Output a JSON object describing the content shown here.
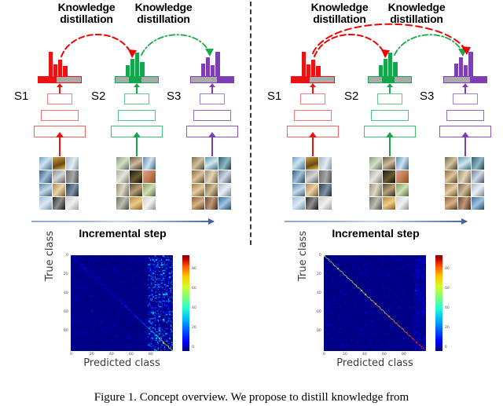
{
  "figure": {
    "caption": "Figure 1. Concept overview. We propose to distill knowledge from",
    "divider": "vertical-dashed-separator"
  },
  "panels": [
    {
      "id": "left",
      "kd_titles": [
        {
          "line1": "Knowledge",
          "line2": "distillation",
          "color": "#000000"
        },
        {
          "line1": "Knowledge",
          "line2": "distillation",
          "color": "#000000"
        }
      ],
      "arcs": [
        {
          "from": "S1",
          "to": "S2",
          "color": "#ee0000",
          "style": "dashed"
        },
        {
          "from": "S2",
          "to": "S3",
          "color": "#1aa94a",
          "style": "dash-dot"
        }
      ],
      "students": [
        {
          "label": "S1",
          "color": "#ee1111",
          "bar_segments": [
            "color",
            "gray"
          ]
        },
        {
          "label": "S2",
          "color": "#13a64a",
          "bar_segments": [
            "gray",
            "color",
            "gray"
          ]
        },
        {
          "label": "S3",
          "color": "#7e3fb5",
          "bar_segments": [
            "gray",
            "color"
          ]
        }
      ],
      "incremental": {
        "label": "Incremental step",
        "arrow": "right-arrow"
      }
    },
    {
      "id": "right",
      "kd_titles": [
        {
          "line1": "Knowledge",
          "line2": "distillation",
          "color": "#000000"
        },
        {
          "line1": "Knowledge",
          "line2": "distillation",
          "color": "#000000"
        }
      ],
      "arcs": [
        {
          "from": "S1",
          "to": "S2",
          "color": "#ee0000",
          "style": "dashed"
        },
        {
          "from": "S2",
          "to": "S3",
          "color": "#1aa94a",
          "style": "dash-dot"
        },
        {
          "from": "S1",
          "to": "S3",
          "color": "#ee0000",
          "style": "dashed"
        }
      ],
      "students": [
        {
          "label": "S1",
          "color": "#ee1111",
          "bar_segments": [
            "color",
            "gray"
          ]
        },
        {
          "label": "S2",
          "color": "#13a64a",
          "bar_segments": [
            "gray",
            "color",
            "gray"
          ]
        },
        {
          "label": "S3",
          "color": "#7e3fb5",
          "bar_segments": [
            "gray",
            "color"
          ]
        }
      ],
      "incremental": {
        "label": "Incremental step",
        "arrow": "right-arrow"
      }
    }
  ],
  "chart_data": [
    {
      "id": "confusion-matrix-left",
      "type": "heatmap",
      "title": "",
      "xlabel": "Predicted class",
      "ylabel": "True class",
      "xticks": [
        0,
        20,
        40,
        60,
        80
      ],
      "yticks": [
        0,
        20,
        40,
        60,
        80
      ],
      "xlim": [
        0,
        100
      ],
      "ylim": [
        0,
        100
      ],
      "colormap": "jet",
      "colorbar": {
        "ticks": [
          0,
          20,
          40,
          60,
          80
        ],
        "vmin": 0,
        "vmax": 95,
        "position": "right"
      },
      "grid": false,
      "description": "Confusion matrix of a baseline incremental learner: weak faint diagonal for early classes, strong red diagonal only near the last classes, heavy prediction bias toward the most recent classes (bright scattered column band on the right).",
      "diagonal_strength": [
        2,
        3,
        4,
        5,
        6,
        8,
        10,
        14,
        20,
        55
      ],
      "recency_bias_band": {
        "start_class": 75,
        "end_class": 100,
        "intensity": 30
      }
    },
    {
      "id": "confusion-matrix-right",
      "type": "heatmap",
      "title": "",
      "xlabel": "Predicted class",
      "ylabel": "True class",
      "xticks": [
        0,
        20,
        40,
        60,
        80
      ],
      "yticks": [
        0,
        20,
        40,
        60,
        80
      ],
      "xlim": [
        0,
        100
      ],
      "ylim": [
        0,
        100
      ],
      "colormap": "jet",
      "colorbar": {
        "ticks": [
          0,
          20,
          40,
          60,
          80
        ],
        "vmin": 0,
        "vmax": 95,
        "position": "right"
      },
      "grid": false,
      "description": "Confusion matrix of the proposed method: a consistently strong diagonal across all classes with only light off-diagonal noise and a much weaker recency bias.",
      "diagonal_strength": [
        45,
        48,
        50,
        52,
        54,
        56,
        58,
        62,
        68,
        80
      ],
      "recency_bias_band": {
        "start_class": 88,
        "end_class": 100,
        "intensity": 10
      }
    }
  ]
}
